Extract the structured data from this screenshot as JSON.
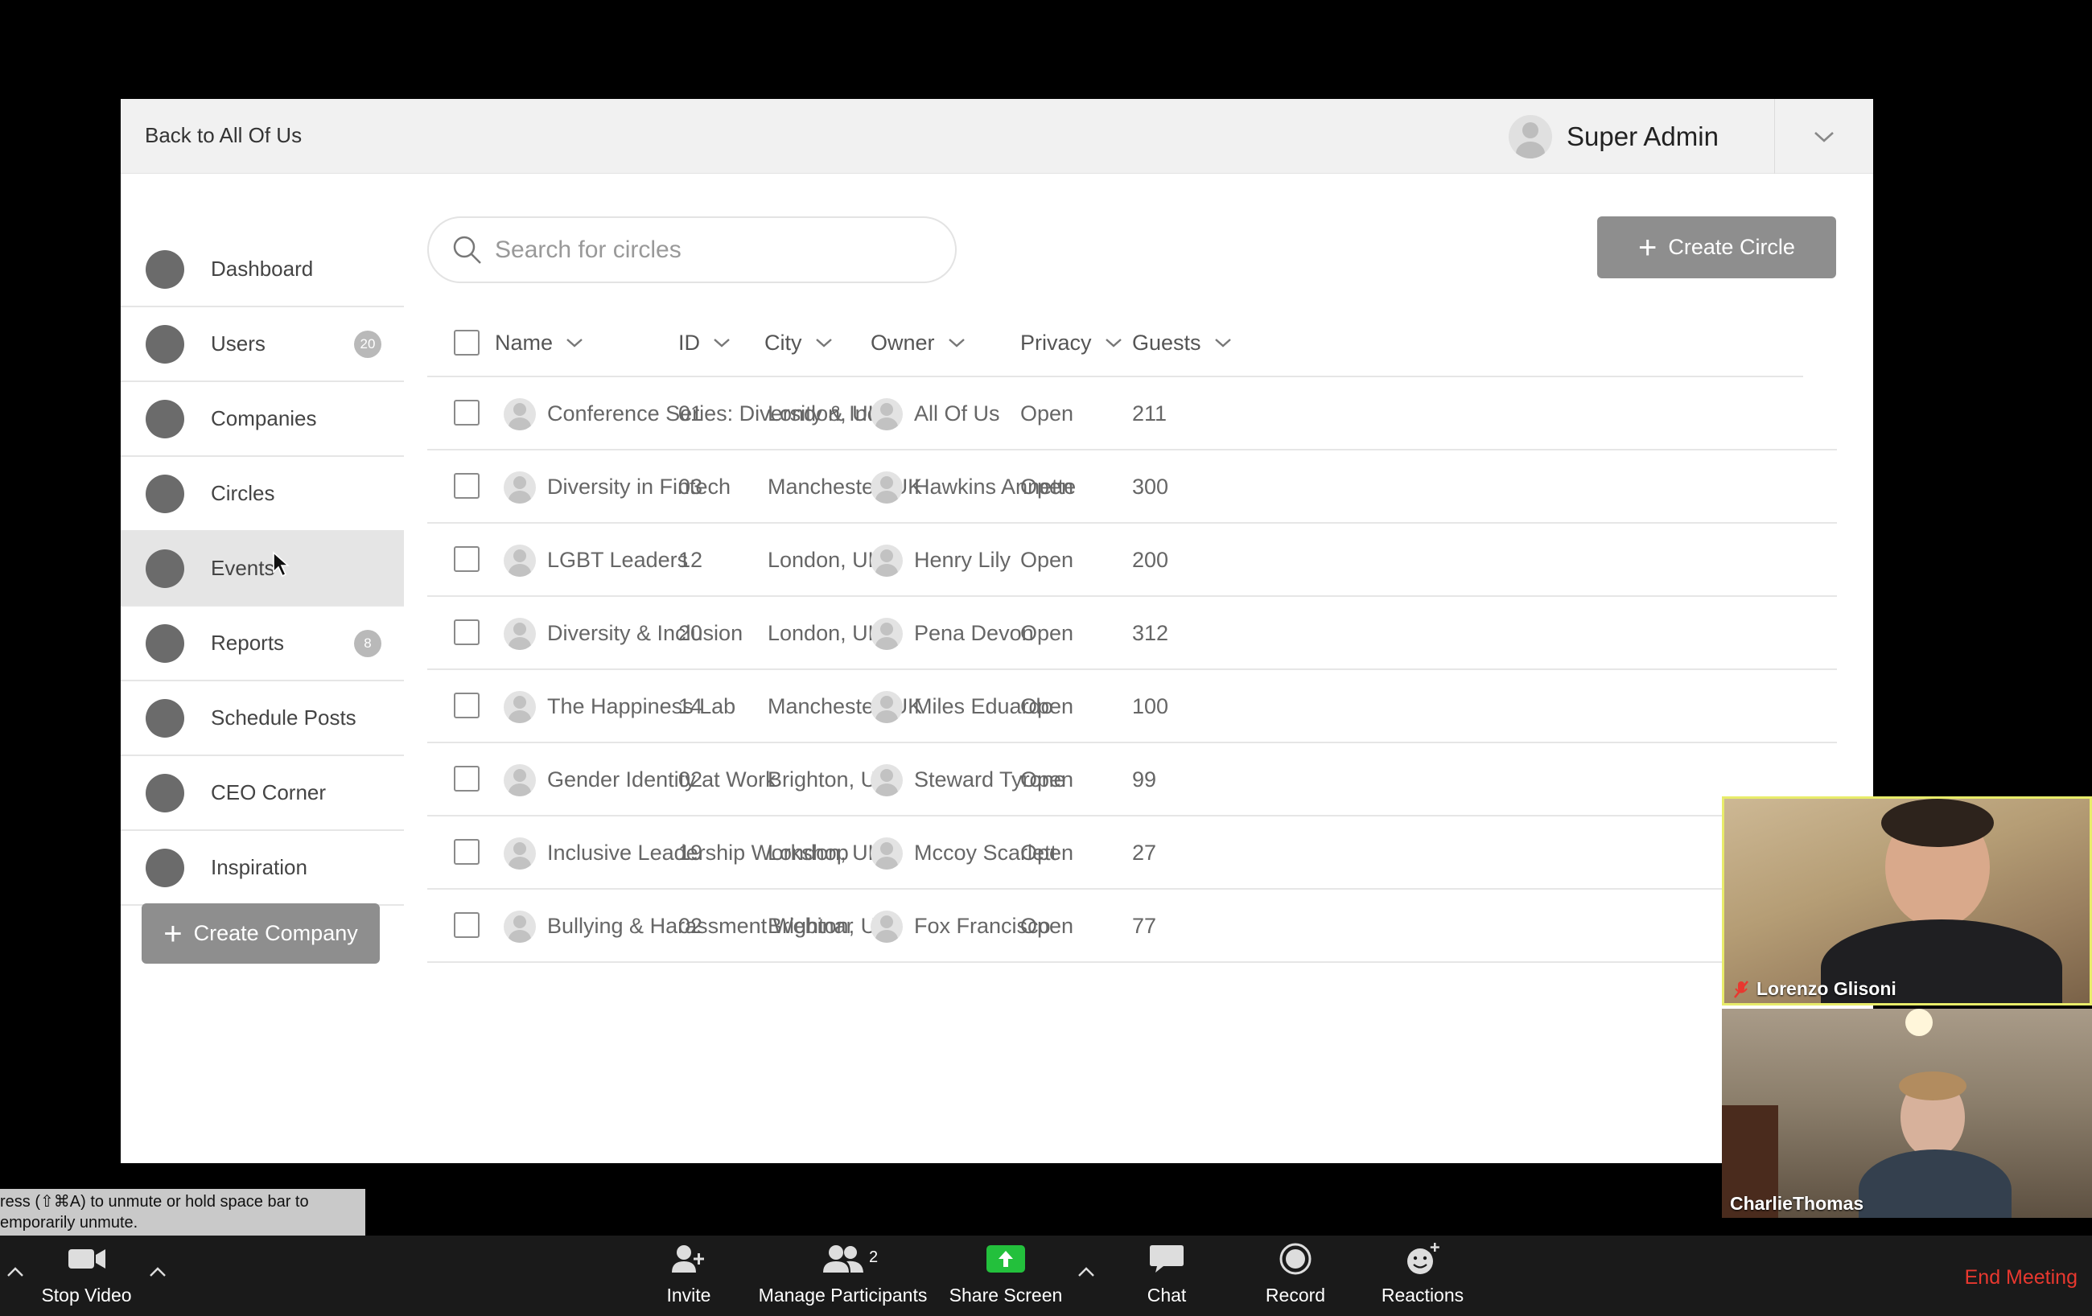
{
  "header": {
    "back_link": "Back to All Of Us",
    "user_name": "Super Admin"
  },
  "sidebar": {
    "items": [
      {
        "label": "Dashboard",
        "badge": ""
      },
      {
        "label": "Users",
        "badge": "20"
      },
      {
        "label": "Companies",
        "badge": ""
      },
      {
        "label": "Circles",
        "badge": ""
      },
      {
        "label": "Events",
        "badge": ""
      },
      {
        "label": "Reports",
        "badge": "8"
      },
      {
        "label": "Schedule Posts",
        "badge": ""
      },
      {
        "label": "CEO Corner",
        "badge": ""
      },
      {
        "label": "Inspiration",
        "badge": ""
      }
    ],
    "active_item": "Events",
    "create_company_label": "Create Company"
  },
  "main": {
    "search_placeholder": "Search for circles",
    "create_circle_label": "Create Circle",
    "columns": [
      "Name",
      "ID",
      "City",
      "Owner",
      "Privacy",
      "Guests"
    ],
    "rows": [
      {
        "name": "Conference Series: Diversity & Inc...",
        "id": "01",
        "city": "London, UK",
        "owner": "All Of Us",
        "privacy": "Open",
        "guests": "211"
      },
      {
        "name": "Diversity in Fintech",
        "id": "03",
        "city": "Manchester, UK",
        "owner": "Hawkins Annette",
        "privacy": "Open",
        "guests": "300"
      },
      {
        "name": "LGBT Leaders",
        "id": "12",
        "city": "London, UK",
        "owner": "Henry Lily",
        "privacy": "Open",
        "guests": "200"
      },
      {
        "name": "Diversity & Inclusion",
        "id": "20",
        "city": "London, UK",
        "owner": "Pena Devon",
        "privacy": "Open",
        "guests": "312"
      },
      {
        "name": "The Happiness Lab",
        "id": "14",
        "city": "Manchester, UK",
        "owner": "Miles Eduardo",
        "privacy": "Open",
        "guests": "100"
      },
      {
        "name": "Gender Identity at Work",
        "id": "02",
        "city": "Brighton, UK",
        "owner": "Steward Tyrone",
        "privacy": "Open",
        "guests": "99"
      },
      {
        "name": "Inclusive Leadership Workshop",
        "id": "19",
        "city": "London, UK",
        "owner": "Mccoy Scarlett",
        "privacy": "Open",
        "guests": "27"
      },
      {
        "name": "Bullying & Harassment Webinar",
        "id": "02",
        "city": "Brighton, UK",
        "owner": "Fox Francisco",
        "privacy": "Open",
        "guests": "77"
      }
    ]
  },
  "videos": [
    {
      "name": "Lorenzo Glisoni",
      "muted": true
    },
    {
      "name": "CharlieThomas",
      "muted": false
    }
  ],
  "tooltip": "ress  (⇧⌘A) to unmute or hold space bar to\nemporarily unmute.",
  "zoom_toolbar": {
    "stop_video": "Stop Video",
    "invite": "Invite",
    "manage_participants": "Manage Participants",
    "participant_count": "2",
    "share_screen": "Share Screen",
    "chat": "Chat",
    "record": "Record",
    "reactions": "Reactions",
    "end_meeting": "End Meeting"
  },
  "colors": {
    "share_green": "#23c03c",
    "end_red": "#e8382f",
    "speaker_border": "#e8ec6a"
  }
}
